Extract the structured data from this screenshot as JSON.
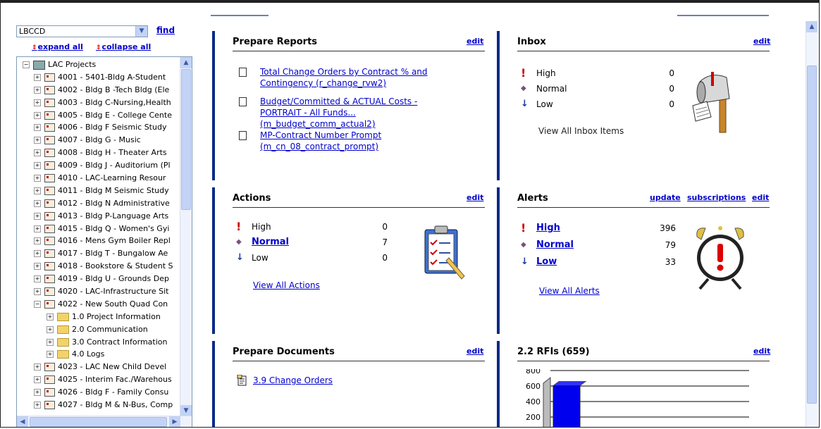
{
  "left": {
    "selected_project": "LBCCD",
    "find": "find",
    "expand_all": "expand all",
    "collapse_all": "collapse all",
    "tree": [
      {
        "text": "LAC Projects",
        "level": 0,
        "type": "root",
        "toggle": "−"
      },
      {
        "text": "4001 - 5401-Bldg A-Student",
        "level": 1,
        "type": "project",
        "toggle": "+"
      },
      {
        "text": "4002 - Bldg B -Tech Bldg (Ele",
        "level": 1,
        "type": "project",
        "toggle": "+"
      },
      {
        "text": "4003 - Bldg C-Nursing,Health",
        "level": 1,
        "type": "project",
        "toggle": "+"
      },
      {
        "text": "4005 - Bldg E - College Cente",
        "level": 1,
        "type": "project",
        "toggle": "+"
      },
      {
        "text": "4006 - Bldg F Seismic Study",
        "level": 1,
        "type": "project",
        "toggle": "+"
      },
      {
        "text": "4007 - Bldg G - Music",
        "level": 1,
        "type": "project",
        "toggle": "+"
      },
      {
        "text": "4008 - Bldg H - Theater Arts",
        "level": 1,
        "type": "project",
        "toggle": "+"
      },
      {
        "text": "4009 - Bldg J - Auditorium (Pl",
        "level": 1,
        "type": "project",
        "toggle": "+"
      },
      {
        "text": "4010 - LAC-Learning Resour",
        "level": 1,
        "type": "project",
        "toggle": "+"
      },
      {
        "text": "4011 - Bldg M Seismic Study",
        "level": 1,
        "type": "project",
        "toggle": "+"
      },
      {
        "text": "4012 - Bldg N Administrative",
        "level": 1,
        "type": "project",
        "toggle": "+"
      },
      {
        "text": "4013 - Bldg P-Language Arts",
        "level": 1,
        "type": "project",
        "toggle": "+"
      },
      {
        "text": "4015 - Bldg Q - Women's Gyi",
        "level": 1,
        "type": "project",
        "toggle": "+"
      },
      {
        "text": "4016 - Mens Gym Boiler Repl",
        "level": 1,
        "type": "project",
        "toggle": "+"
      },
      {
        "text": "4017 - Bldg T - Bungalow Ae",
        "level": 1,
        "type": "project",
        "toggle": "+"
      },
      {
        "text": "4018 - Bookstore & Student S",
        "level": 1,
        "type": "project",
        "toggle": "+"
      },
      {
        "text": "4019 - Bldg U - Grounds Dep",
        "level": 1,
        "type": "project",
        "toggle": "+"
      },
      {
        "text": "4020 - LAC-Infrastructure Sit",
        "level": 1,
        "type": "project",
        "toggle": "+"
      },
      {
        "text": "4022 - New South Quad Con",
        "level": 1,
        "type": "project",
        "toggle": "−"
      },
      {
        "text": "1.0 Project Information",
        "level": 2,
        "type": "folder",
        "toggle": "+"
      },
      {
        "text": "2.0 Communication",
        "level": 2,
        "type": "folder",
        "toggle": "+"
      },
      {
        "text": "3.0 Contract Information",
        "level": 2,
        "type": "folder",
        "toggle": "+"
      },
      {
        "text": "4.0 Logs",
        "level": 2,
        "type": "folder",
        "toggle": "+"
      },
      {
        "text": "4023 - LAC New Child Devel",
        "level": 1,
        "type": "project",
        "toggle": "+"
      },
      {
        "text": "4025 - Interim Fac./Warehous",
        "level": 1,
        "type": "project",
        "toggle": "+"
      },
      {
        "text": "4026 - Bldg F - Family Consu",
        "level": 1,
        "type": "project",
        "toggle": "+"
      },
      {
        "text": "4027 - Bldg M & N-Bus, Comp",
        "level": 1,
        "type": "project",
        "toggle": "+"
      }
    ]
  },
  "reports": {
    "title": "Prepare Reports",
    "edit": "edit",
    "items": [
      {
        "line1": "Total Change Orders by Contract % and",
        "line2": "Contingency (r_change_rvw2)",
        "line3": ""
      },
      {
        "line1": "Budget/Committed & ACTUAL Costs -",
        "line2": "PORTRAIT - All Funds...",
        "line3": "(m_budget_comm_actual2)"
      },
      {
        "line1": "MP-Contract Number Prompt",
        "line2": "(m_cn_08_contract_prompt)",
        "line3": ""
      }
    ]
  },
  "inbox": {
    "title": "Inbox",
    "edit": "edit",
    "rows": [
      {
        "label": "High",
        "count": "0",
        "icon": "red-exclamation-icon"
      },
      {
        "label": "Normal",
        "count": "0",
        "icon": "purple-diamond-icon"
      },
      {
        "label": "Low",
        "count": "0",
        "icon": "blue-down-arrow-icon"
      }
    ],
    "view_all": "View All Inbox Items"
  },
  "actions": {
    "title": "Actions",
    "edit": "edit",
    "rows": [
      {
        "label": "High",
        "count": "0"
      },
      {
        "label": "Normal",
        "count": "7"
      },
      {
        "label": "Low",
        "count": "0"
      }
    ],
    "view_all": "View All Actions"
  },
  "alerts": {
    "title": "Alerts",
    "update": "update",
    "subscriptions": "subscriptions",
    "edit": "edit",
    "rows": [
      {
        "label": "High",
        "count": "396"
      },
      {
        "label": "Normal",
        "count": "79"
      },
      {
        "label": "Low",
        "count": "33"
      }
    ],
    "view_all": "View All Alerts"
  },
  "documents": {
    "title": "Prepare Documents",
    "edit": "edit",
    "item": "3.9 Change Orders"
  },
  "rfis": {
    "title": "2.2 RFIs (659)",
    "edit": "edit"
  },
  "chart_data": {
    "type": "bar",
    "title": "",
    "categories": [
      "",
      "",
      "",
      ""
    ],
    "values": [
      659,
      0,
      0,
      0
    ],
    "yticks": [
      "800",
      "600",
      "400",
      "200"
    ],
    "ylim": [
      0,
      800
    ],
    "colors": [
      "#0000ee",
      "#cc0000",
      "#cc0000",
      "#008080"
    ]
  }
}
